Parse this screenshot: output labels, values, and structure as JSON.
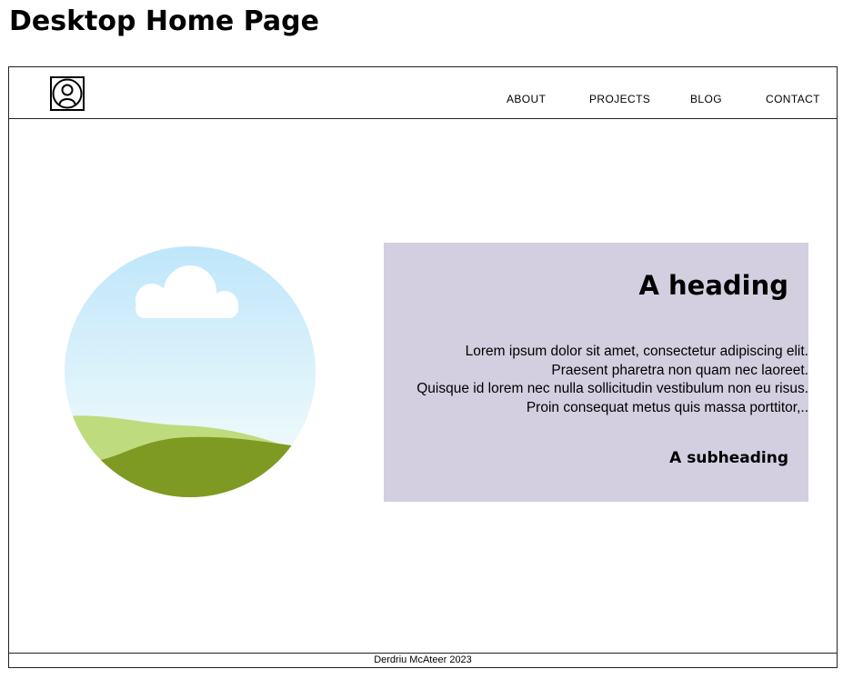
{
  "page_title": "Desktop Home Page",
  "nav": {
    "logo_icon": "user-portrait-icon",
    "links": [
      {
        "label": "ABOUT"
      },
      {
        "label": "PROJECTS"
      },
      {
        "label": "BLOG"
      },
      {
        "label": "CONTACT"
      }
    ]
  },
  "hero": {
    "image_icon": "landscape-image-icon",
    "heading": "A heading",
    "body_lines": [
      "Lorem ipsum dolor sit amet, consectetur adipiscing elit.",
      "Praesent pharetra non quam nec laoreet.",
      "Quisque id lorem nec nulla sollicitudin vestibulum non eu risus.",
      "Proin consequat metus quis massa porttitor,.."
    ],
    "subheading": "A subheading"
  },
  "footer": {
    "text": "Derdriu McAteer 2023"
  },
  "colors": {
    "content_box_bg": "#d3cfe1",
    "sky_top": "#bfe6fb",
    "hill_light": "#bedb7e",
    "hill_dark": "#7e9a22"
  }
}
